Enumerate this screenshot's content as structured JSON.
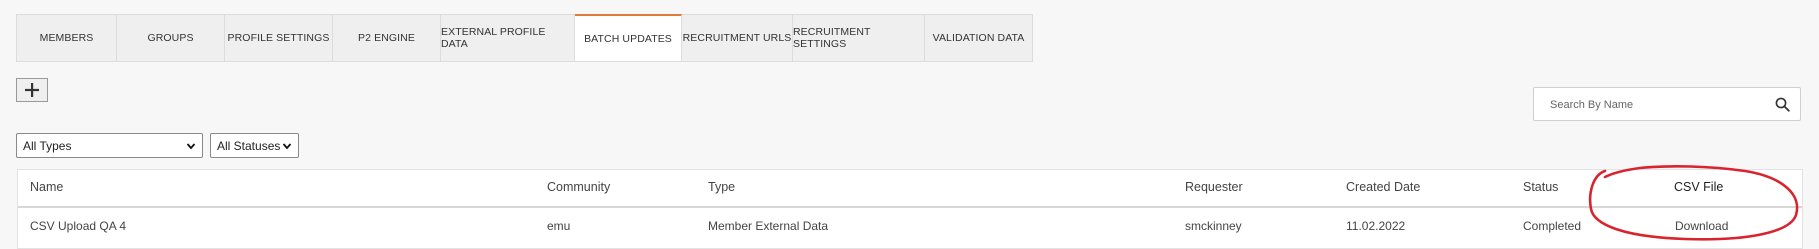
{
  "tabs": [
    {
      "label": "MEMBERS",
      "active": false
    },
    {
      "label": "GROUPS",
      "active": false
    },
    {
      "label": "PROFILE SETTINGS",
      "active": false
    },
    {
      "label": "P2 ENGINE",
      "active": false
    },
    {
      "label": "EXTERNAL PROFILE DATA",
      "active": false
    },
    {
      "label": "BATCH UPDATES",
      "active": true
    },
    {
      "label": "RECRUITMENT URLS",
      "active": false
    },
    {
      "label": "RECRUITMENT SETTINGS",
      "active": false
    },
    {
      "label": "VALIDATION DATA",
      "active": false
    }
  ],
  "toolbar": {
    "add_icon": "plus-icon"
  },
  "search": {
    "placeholder": "Search By Name",
    "value": "",
    "icon": "search-icon"
  },
  "filters": {
    "type_select": "All Types",
    "status_select": "All Statuses"
  },
  "table": {
    "headers": {
      "name": "Name",
      "community": "Community",
      "type": "Type",
      "requester": "Requester",
      "created": "Created Date",
      "status": "Status",
      "csv": "CSV File"
    },
    "rows": [
      {
        "name": "CSV Upload QA 4",
        "community": "emu",
        "type": "Member External Data",
        "requester": "smckinney",
        "created": "11.02.2022",
        "status": "Completed",
        "csv": "Download"
      }
    ]
  },
  "colors": {
    "accent": "#e07b39",
    "annotation": "#d9232f"
  }
}
